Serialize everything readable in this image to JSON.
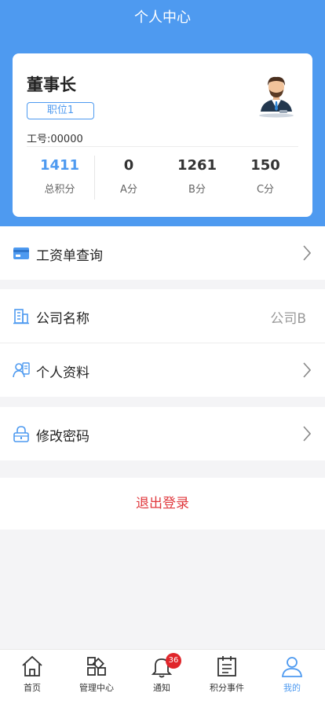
{
  "header": {
    "title": "个人中心"
  },
  "profile": {
    "name": "董事长",
    "position": "职位1",
    "employee_id": "工号:00000",
    "stats": [
      {
        "value": "1411",
        "label": "总积分"
      },
      {
        "value": "0",
        "label": "A分"
      },
      {
        "value": "1261",
        "label": "B分"
      },
      {
        "value": "150",
        "label": "C分"
      }
    ]
  },
  "menu": {
    "salary": {
      "label": "工资单查询"
    },
    "company": {
      "label": "公司名称",
      "value": "公司B"
    },
    "personal": {
      "label": "个人资料"
    },
    "password": {
      "label": "修改密码"
    }
  },
  "logout": {
    "label": "退出登录"
  },
  "tabbar": {
    "items": [
      {
        "label": "首页"
      },
      {
        "label": "管理中心"
      },
      {
        "label": "通知",
        "badge": "36"
      },
      {
        "label": "积分事件"
      },
      {
        "label": "我的"
      }
    ],
    "active_color": "#4e9af0"
  },
  "colors": {
    "accent": "#4e9af0",
    "danger": "#e0393e"
  }
}
